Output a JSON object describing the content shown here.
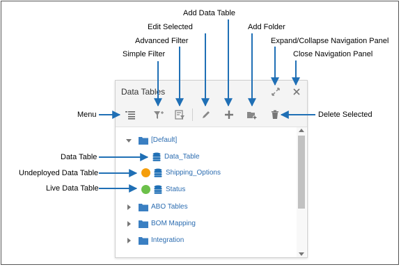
{
  "callouts": {
    "add_data_table": "Add Data Table",
    "edit_selected": "Edit Selected",
    "add_folder": "Add Folder",
    "advanced_filter": "Advanced Filter",
    "expand_collapse": "Expand/Collapse Navigation Panel",
    "simple_filter": "Simple Filter",
    "close_panel": "Close Navigation Panel",
    "menu": "Menu",
    "delete_selected": "Delete Selected",
    "data_table": "Data Table",
    "undeployed_data_table": "Undeployed Data Table",
    "live_data_table": "Live Data Table"
  },
  "panel": {
    "title": "Data Tables",
    "header_icons": [
      "expand-collapse-icon",
      "close-icon"
    ],
    "toolbar_icons": [
      "menu-icon",
      "simple-filter-icon",
      "advanced-filter-icon",
      "edit-icon",
      "add-icon",
      "add-folder-icon",
      "delete-icon"
    ]
  },
  "tree": {
    "default_folder": "[Default]",
    "items": [
      {
        "label": "Data_Table",
        "status": "none"
      },
      {
        "label": "Shipping_Options",
        "status": "undeployed"
      },
      {
        "label": "Status",
        "status": "live"
      }
    ],
    "folders": [
      "ABO Tables",
      "BOM Mapping",
      "Integration"
    ]
  },
  "colors": {
    "accent": "#2b6cb0",
    "arrow": "#1f6fb5",
    "undeployed": "#f59e0b",
    "live": "#6cc04a"
  }
}
